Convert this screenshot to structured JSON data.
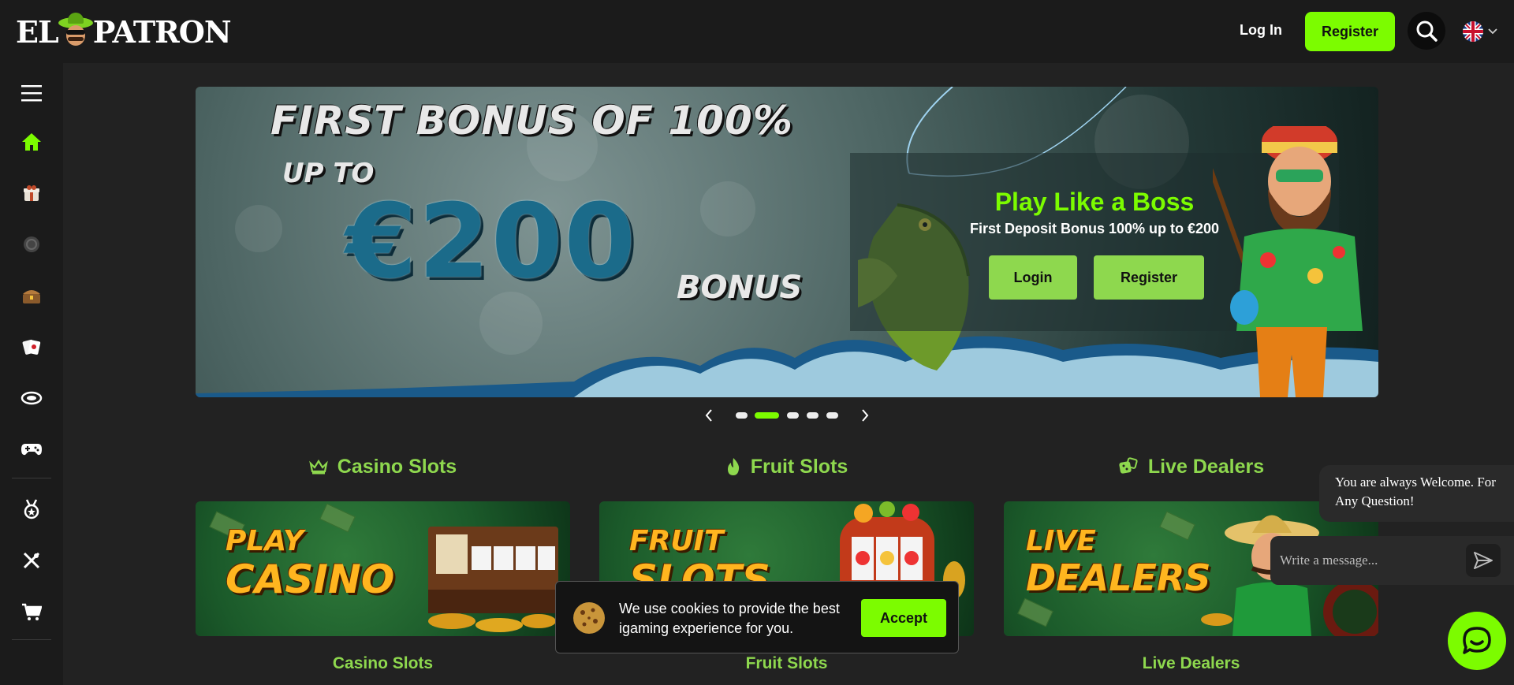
{
  "header": {
    "logo_text_left": "EL",
    "logo_text_right": "PATRON",
    "login_label": "Log In",
    "register_label": "Register",
    "search_icon": "search-icon",
    "language_icon": "uk-flag-icon"
  },
  "sidebar": {
    "items": [
      {
        "icon": "menu-icon"
      },
      {
        "icon": "home-icon",
        "active": true
      },
      {
        "icon": "gift-icon"
      },
      {
        "icon": "poker-chip-icon"
      },
      {
        "icon": "treasure-chest-icon"
      },
      {
        "icon": "cards-icon"
      },
      {
        "icon": "table-icon"
      },
      {
        "icon": "gamepad-icon"
      },
      {
        "icon": "medal-icon"
      },
      {
        "icon": "sports-icon"
      },
      {
        "icon": "cart-icon"
      }
    ]
  },
  "banner": {
    "headline": "FIRST BONUS OF 100%",
    "upto": "UP TO",
    "amount": "€200",
    "bonus_word": "BONUS",
    "promo_title": "Play Like a Boss",
    "promo_subtitle": "First Deposit Bonus 100% up to €200",
    "login_button": "Login",
    "register_button": "Register"
  },
  "carousel": {
    "slides": 5,
    "active_index": 1
  },
  "categories": [
    {
      "title": "Casino Slots",
      "icon": "crown-icon",
      "card_line1": "PLAY",
      "card_line2": "CASINO",
      "label": "Casino Slots"
    },
    {
      "title": "Fruit Slots",
      "icon": "flame-icon",
      "card_line1": "FRUIT",
      "card_line2": "SLOTS",
      "label": "Fruit Slots"
    },
    {
      "title": "Live Dealers",
      "icon": "dice-icon",
      "card_line1": "LIVE",
      "card_line2": "DEALERS",
      "label": "Live Dealers"
    }
  ],
  "cookie": {
    "text": "We use cookies to provide the best igaming experience for you.",
    "accept_label": "Accept"
  },
  "chat": {
    "welcome": "You are always Welcome. For Any Question!",
    "placeholder": "Write a message..."
  },
  "colors": {
    "accent": "#7cfc00",
    "accent_soft": "#8ed84e",
    "background": "#222222",
    "header_bg": "#1b1b1b"
  }
}
